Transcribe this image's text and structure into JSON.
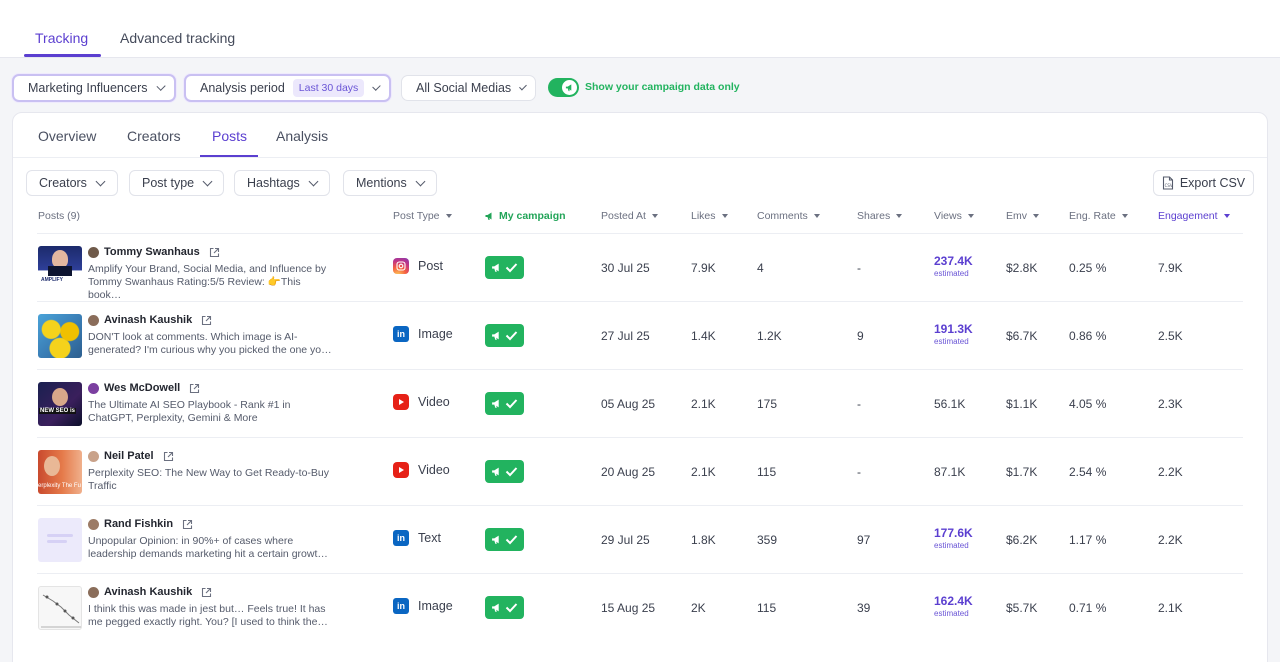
{
  "top_tabs": [
    {
      "label": "Tracking",
      "active": true
    },
    {
      "label": "Advanced tracking",
      "active": false
    }
  ],
  "filters": {
    "list": "Marketing Influencers",
    "analysis_period_label": "Analysis period",
    "analysis_period_value": "Last 30 days",
    "social": "All Social Medias",
    "campaign_toggle_label": "Show your campaign data only",
    "campaign_toggle_on": true
  },
  "sub_tabs": [
    {
      "label": "Overview",
      "active": false
    },
    {
      "label": "Creators",
      "active": false
    },
    {
      "label": "Posts",
      "active": true
    },
    {
      "label": "Analysis",
      "active": false
    }
  ],
  "sub_filters": [
    "Creators",
    "Post type",
    "Hashtags",
    "Mentions"
  ],
  "export_label": "Export CSV",
  "columns": {
    "posts": "Posts (9)",
    "post_type": "Post Type",
    "campaign": "My campaign",
    "posted_at": "Posted At",
    "likes": "Likes",
    "comments": "Comments",
    "shares": "Shares",
    "views": "Views",
    "emv": "Emv",
    "eng_rate": "Eng. Rate",
    "engagement": "Engagement"
  },
  "colors": {
    "accent": "#5b3fd0",
    "campaign_green": "#22b35f"
  },
  "rows": [
    {
      "creator": "Tommy Swanhaus",
      "caption": "Amplify Your Brand, Social Media, and Influence by Tommy Swanhaus Rating:5/5 Review: 👉This book…",
      "post_type": "Post",
      "platform": "instagram",
      "posted_at": "30 Jul 25",
      "likes": "7.9K",
      "comments": "4",
      "shares": "-",
      "views": "237.4K",
      "views_note": "estimated",
      "emv": "$2.8K",
      "eng_rate": "0.25 %",
      "engagement": "7.9K"
    },
    {
      "creator": "Avinash Kaushik",
      "caption": "DON'T look at comments. Which image is AI-generated? I'm curious why you picked the one yo…",
      "post_type": "Image",
      "platform": "linkedin",
      "posted_at": "27 Jul 25",
      "likes": "1.4K",
      "comments": "1.2K",
      "shares": "9",
      "views": "191.3K",
      "views_note": "estimated",
      "emv": "$6.7K",
      "eng_rate": "0.86 %",
      "engagement": "2.5K"
    },
    {
      "creator": "Wes McDowell",
      "caption": "The Ultimate AI SEO Playbook - Rank #1 in ChatGPT, Perplexity, Gemini & More",
      "post_type": "Video",
      "platform": "youtube",
      "posted_at": "05 Aug 25",
      "likes": "2.1K",
      "comments": "175",
      "shares": "-",
      "views": "56.1K",
      "views_note": "",
      "emv": "$1.1K",
      "eng_rate": "4.05 %",
      "engagement": "2.3K"
    },
    {
      "creator": "Neil Patel",
      "caption": "Perplexity SEO: The New Way to Get Ready-to-Buy Traffic",
      "post_type": "Video",
      "platform": "youtube",
      "posted_at": "20 Aug 25",
      "likes": "2.1K",
      "comments": "115",
      "shares": "-",
      "views": "87.1K",
      "views_note": "",
      "emv": "$1.7K",
      "eng_rate": "2.54 %",
      "engagement": "2.2K"
    },
    {
      "creator": "Rand Fishkin",
      "caption": "Unpopular Opinion: in 90%+ of cases where leadership demands marketing hit a certain growt…",
      "post_type": "Text",
      "platform": "linkedin",
      "posted_at": "29 Jul 25",
      "likes": "1.8K",
      "comments": "359",
      "shares": "97",
      "views": "177.6K",
      "views_note": "estimated",
      "emv": "$6.2K",
      "eng_rate": "1.17 %",
      "engagement": "2.2K"
    },
    {
      "creator": "Avinash Kaushik",
      "caption": "I think this was made in jest but… Feels true! It has me pegged exactly right. You? [I used to think the…",
      "post_type": "Image",
      "platform": "linkedin",
      "posted_at": "15 Aug 25",
      "likes": "2K",
      "comments": "115",
      "shares": "39",
      "views": "162.4K",
      "views_note": "estimated",
      "emv": "$5.7K",
      "eng_rate": "0.71 %",
      "engagement": "2.1K"
    }
  ]
}
